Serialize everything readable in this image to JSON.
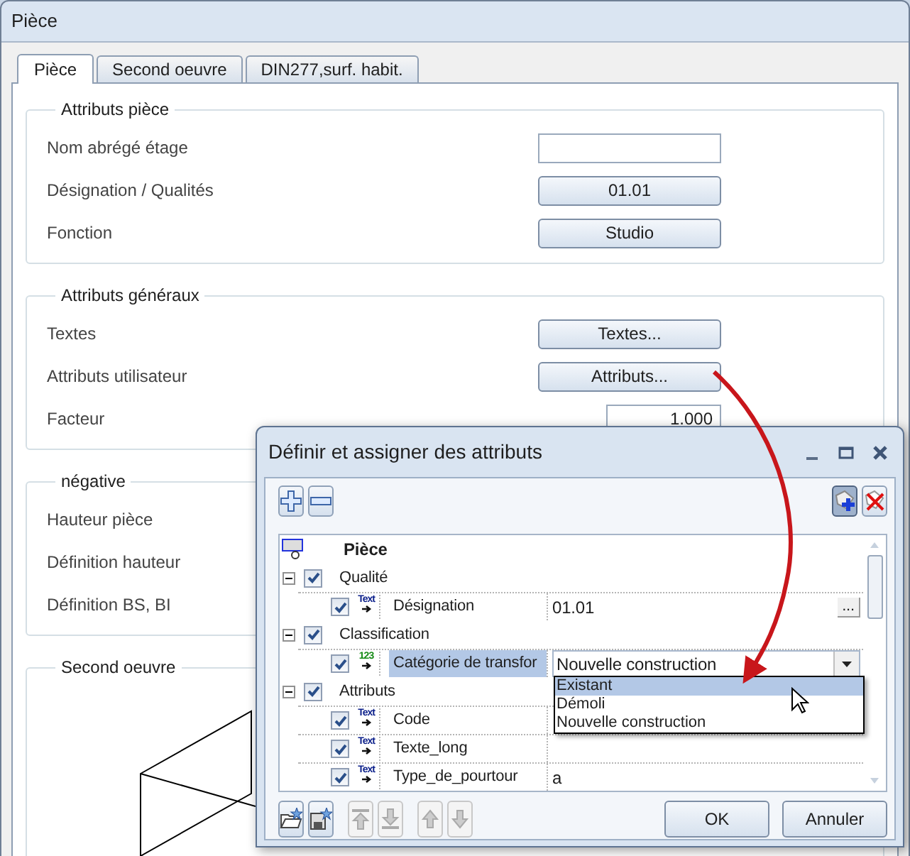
{
  "window": {
    "title": "Pièce"
  },
  "tabs": [
    {
      "label": "Pièce",
      "selected": true
    },
    {
      "label": "Second oeuvre",
      "selected": false
    },
    {
      "label": "DIN277,surf. habit.",
      "selected": false
    }
  ],
  "groups": [
    {
      "title": "Attributs pièce",
      "kind": "form",
      "rows": [
        {
          "label": "Nom abrégé étage",
          "kind": "input"
        },
        {
          "label": "Désignation / Qualités",
          "kind": "button",
          "value": "01.01"
        },
        {
          "label": "Fonction",
          "kind": "button",
          "value": "Studio"
        }
      ]
    },
    {
      "title": "Attributs généraux",
      "kind": "form",
      "rows": [
        {
          "label": "Textes",
          "kind": "button",
          "value": "Textes..."
        },
        {
          "label": "Attributs utilisateur",
          "kind": "button",
          "value": "Attributs..."
        },
        {
          "label": "Facteur",
          "kind": "number",
          "value": "1.000"
        }
      ]
    },
    {
      "title": "négative",
      "kind": "form",
      "rows": [
        {
          "label": "Hauteur pièce",
          "kind": "label"
        },
        {
          "label": "Définition hauteur",
          "kind": "label"
        },
        {
          "label": "Définition BS, BI",
          "kind": "label"
        }
      ]
    },
    {
      "title": "Second oeuvre",
      "kind": "preview"
    }
  ],
  "dialog": {
    "title": "Définir et assigner des attributs",
    "toolbar_left": [
      {
        "kind": "add"
      },
      {
        "kind": "remove"
      }
    ],
    "toolbar_right": [
      {
        "kind": "new",
        "pressed": true
      },
      {
        "kind": "delete",
        "pressed": false
      }
    ],
    "tree": {
      "root": "Pièce",
      "children": [
        {
          "label": "Qualité",
          "checked": true,
          "expanded": true,
          "children": [
            {
              "label": "Désignation",
              "type_label": "Text",
              "kind": "text",
              "checked": true,
              "selected": false,
              "value": "01.01",
              "browse": "..."
            }
          ]
        },
        {
          "label": "Classification",
          "checked": true,
          "expanded": true,
          "children": [
            {
              "label": "Catégorie de transfor",
              "type_label": "123",
              "kind": "number",
              "checked": true,
              "selected": true,
              "value": "Nouvelle construction",
              "combo": true
            }
          ]
        },
        {
          "label": "Attributs",
          "checked": true,
          "expanded": true,
          "children": [
            {
              "label": "Code",
              "type_label": "Text",
              "kind": "text",
              "checked": true,
              "selected": false
            },
            {
              "label": "Texte_long",
              "type_label": "Text",
              "kind": "text",
              "checked": true,
              "selected": false
            },
            {
              "label": "Type_de_pourtour",
              "type_label": "Text",
              "kind": "text",
              "checked": true,
              "selected": false,
              "value": "a"
            }
          ]
        }
      ]
    },
    "dropdown": {
      "options": [
        {
          "label": "Existant",
          "selected": true
        },
        {
          "label": "Démoli",
          "selected": false
        },
        {
          "label": "Nouvelle construction",
          "selected": false
        }
      ]
    },
    "bottom_tools": [
      {
        "kind": "open",
        "disabled": false
      },
      {
        "kind": "save",
        "disabled": false
      },
      {
        "kind": "top",
        "disabled": true
      },
      {
        "kind": "bottom",
        "disabled": true
      },
      {
        "kind": "up",
        "disabled": true
      },
      {
        "kind": "down",
        "disabled": true
      }
    ],
    "buttons": [
      {
        "label": "OK"
      },
      {
        "label": "Annuler"
      }
    ]
  }
}
